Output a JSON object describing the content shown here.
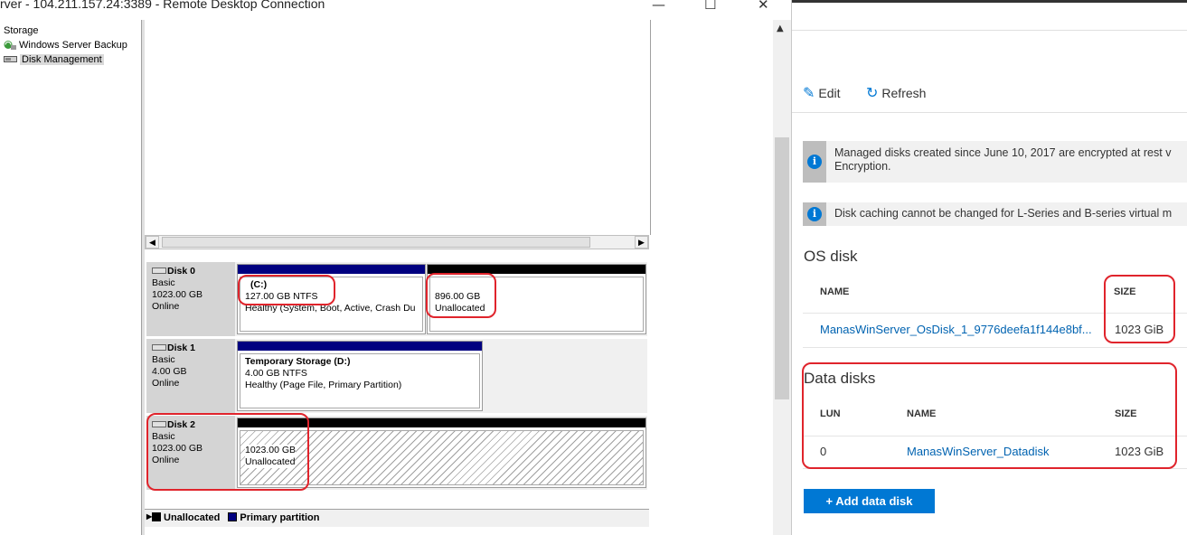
{
  "rdp": {
    "title": "rver - 104.211.157.24:3389 - Remote Desktop Connection",
    "tree": [
      "Storage",
      "Windows Server Backup",
      "Disk Management"
    ],
    "disks": [
      {
        "name": "Disk 0",
        "type": "Basic",
        "size": "1023.00 GB",
        "status": "Online",
        "partitions": [
          {
            "title": "(C:)",
            "size": "127.00 GB NTFS",
            "status": "Healthy (System, Boot, Active, Crash Du"
          },
          {
            "size": "896.00 GB",
            "status": "Unallocated"
          }
        ]
      },
      {
        "name": "Disk 1",
        "type": "Basic",
        "size": "4.00 GB",
        "status": "Online",
        "partitions": [
          {
            "title": "Temporary Storage  (D:)",
            "size": "4.00 GB NTFS",
            "status": "Healthy (Page File, Primary Partition)"
          }
        ]
      },
      {
        "name": "Disk 2",
        "type": "Basic",
        "size": "1023.00 GB",
        "status": "Online",
        "partitions": [
          {
            "size": "1023.00 GB",
            "status": "Unallocated"
          }
        ]
      }
    ],
    "legend": {
      "unallocated": "Unallocated",
      "primary": "Primary partition"
    },
    "colors": {
      "primary_bar": "#000080",
      "unallocated_bar": "#000000",
      "annotation": "#e0242c"
    }
  },
  "azure": {
    "toolbar": {
      "edit": "Edit",
      "refresh": "Refresh"
    },
    "notices": [
      "Managed disks created since June 10, 2017 are encrypted at rest v",
      "Encryption.",
      "Disk caching cannot be changed for L-Series and B-series virtual m"
    ],
    "os_disk": {
      "title": "OS disk",
      "headers": {
        "name": "NAME",
        "size": "SIZE"
      },
      "name": "ManasWinServer_OsDisk_1_9776deefa1f144e8bf...",
      "size": "1023 GiB"
    },
    "data_disks": {
      "title": "Data disks",
      "headers": {
        "lun": "LUN",
        "name": "NAME",
        "size": "SIZE"
      },
      "rows": [
        {
          "lun": "0",
          "name": "ManasWinServer_Datadisk",
          "size": "1023 GiB"
        }
      ]
    },
    "add_button": "+ Add data disk",
    "colors": {
      "accent": "#0078d4",
      "link": "#0063b1"
    }
  }
}
